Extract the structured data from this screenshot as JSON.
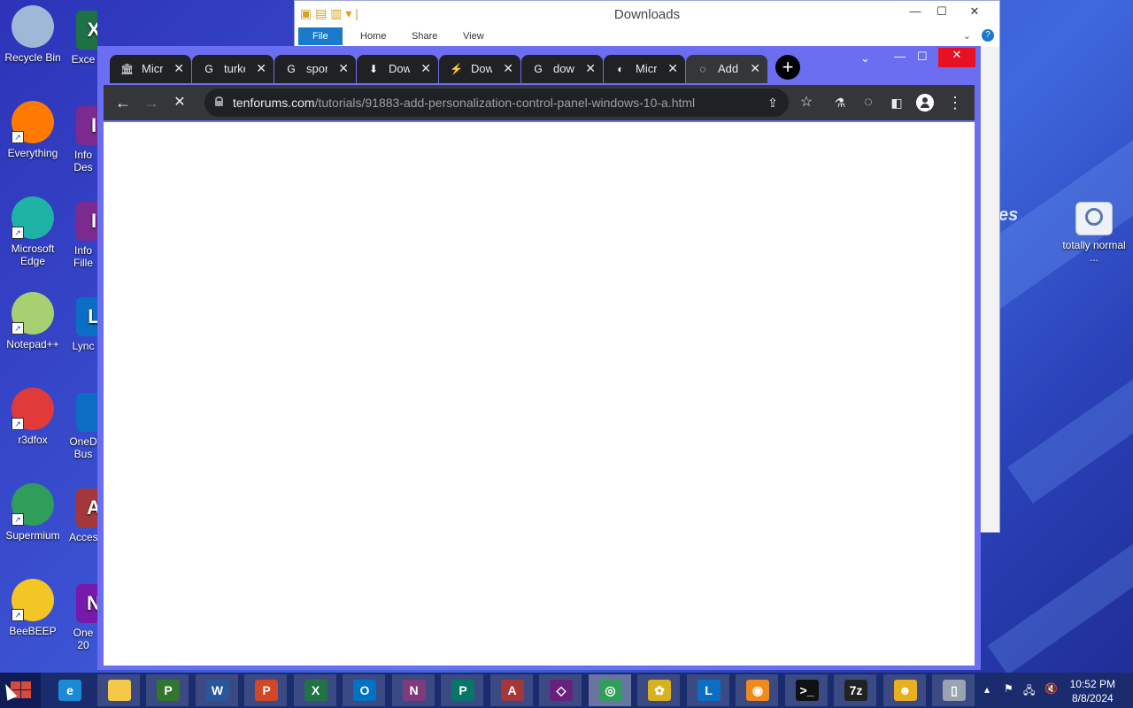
{
  "desktop": {
    "left_icons": [
      {
        "label": "Recycle Bin",
        "icon": "recycle-bin-icon",
        "color": "#9fb8d8"
      },
      {
        "label": "Everything",
        "icon": "everything-search-icon",
        "color": "#ff7a00"
      },
      {
        "label": "Microsoft Edge",
        "icon": "edge-icon",
        "color": "#1fb3a5"
      },
      {
        "label": "Notepad++",
        "icon": "notepad-plus-plus-icon",
        "color": "#a8d070"
      },
      {
        "label": "r3dfox",
        "icon": "r3dfox-icon",
        "color": "#e03a3a"
      },
      {
        "label": "Supermium",
        "icon": "supermium-icon",
        "color": "#2e9e5a"
      },
      {
        "label": "BeeBEEP",
        "icon": "beebeep-icon",
        "color": "#f3c623"
      }
    ],
    "second_icons": [
      {
        "label": "Exce",
        "icon": "excel-icon",
        "color": "#1e7145",
        "letter": "X"
      },
      {
        "label": "Info Des",
        "icon": "infopath-designer-icon",
        "color": "#7b2a8f",
        "letter": "I"
      },
      {
        "label": "Info Fille",
        "icon": "infopath-filler-icon",
        "color": "#7b2a8f",
        "letter": "I"
      },
      {
        "label": "Lync",
        "icon": "lync-icon",
        "color": "#0b6ec4",
        "letter": "L"
      },
      {
        "label": "OneD Bus",
        "icon": "onedrive-business-icon",
        "color": "#0b6ec4",
        "letter": ""
      },
      {
        "label": "Acces",
        "icon": "access-icon",
        "color": "#a4373a",
        "letter": "A"
      },
      {
        "label": "One 20",
        "icon": "onenote-icon",
        "color": "#7719aa",
        "letter": "N"
      }
    ],
    "right_icon": {
      "label": "totally normal ...",
      "icon": "settings-file-icon"
    },
    "wallpaper_text": "es"
  },
  "explorer": {
    "title": "Downloads",
    "ribbon_tabs": [
      "File",
      "Home",
      "Share",
      "View"
    ]
  },
  "browser": {
    "tabs": [
      {
        "title": "Micr",
        "icon": "museum-icon",
        "glyph": "🏛"
      },
      {
        "title": "turke",
        "icon": "google-icon",
        "glyph": "G"
      },
      {
        "title": "spor",
        "icon": "google-icon",
        "glyph": "G"
      },
      {
        "title": "Dow",
        "icon": "download-icon",
        "glyph": "⬇"
      },
      {
        "title": "Dow",
        "icon": "bolt-icon",
        "glyph": "⚡"
      },
      {
        "title": "dow",
        "icon": "google-icon",
        "glyph": "G"
      },
      {
        "title": "Micr",
        "icon": "tenforums-icon",
        "glyph": "◐"
      },
      {
        "title": "Add",
        "icon": "loading-icon",
        "glyph": "◌"
      }
    ],
    "active_tab": 7,
    "url_domain": "tenforums.com",
    "url_path": "/tutorials/91883-add-personalization-control-panel-windows-10-a.html"
  },
  "taskbar": {
    "items": [
      {
        "name": "internet-explorer",
        "icon": "internet-explorer-icon",
        "label": "e",
        "color": "#1a8ad4"
      },
      {
        "name": "file-explorer",
        "icon": "file-explorer-icon",
        "label": "",
        "color": "#f5c848"
      },
      {
        "name": "project",
        "icon": "project-icon",
        "label": "P",
        "color": "#31752f"
      },
      {
        "name": "word",
        "icon": "word-icon",
        "label": "W",
        "color": "#2b579a"
      },
      {
        "name": "powerpoint",
        "icon": "powerpoint-icon",
        "label": "P",
        "color": "#d24726"
      },
      {
        "name": "excel",
        "icon": "excel-icon",
        "label": "X",
        "color": "#217346"
      },
      {
        "name": "outlook",
        "icon": "outlook-icon",
        "label": "O",
        "color": "#0072c6"
      },
      {
        "name": "onenote",
        "icon": "onenote-icon",
        "label": "N",
        "color": "#80397b"
      },
      {
        "name": "publisher",
        "icon": "publisher-icon",
        "label": "P",
        "color": "#077568"
      },
      {
        "name": "access",
        "icon": "access-icon",
        "label": "A",
        "color": "#a4373a"
      },
      {
        "name": "visual-studio",
        "icon": "visual-studio-icon",
        "label": "◇",
        "color": "#68217a"
      },
      {
        "name": "supermium",
        "icon": "supermium-icon",
        "label": "◎",
        "color": "#2e9e5a"
      },
      {
        "name": "beebeep",
        "icon": "beebeep-icon",
        "label": "✿",
        "color": "#d8b21e"
      },
      {
        "name": "lync",
        "icon": "lync-icon",
        "label": "L",
        "color": "#0b6ec4"
      },
      {
        "name": "browser",
        "icon": "orange-sphere-icon",
        "label": "◉",
        "color": "#f08a1c"
      },
      {
        "name": "command-prompt",
        "icon": "command-prompt-icon",
        "label": ">_",
        "color": "#111111"
      },
      {
        "name": "7zip",
        "icon": "7zip-icon",
        "label": "7z",
        "color": "#222222"
      },
      {
        "name": "app",
        "icon": "mascot-icon",
        "label": "☻",
        "color": "#e8b020"
      },
      {
        "name": "recycle",
        "icon": "recycle-bin-icon",
        "label": "▯",
        "color": "#9aa4b0"
      }
    ],
    "time": "10:52 PM",
    "date": "8/8/2024"
  }
}
